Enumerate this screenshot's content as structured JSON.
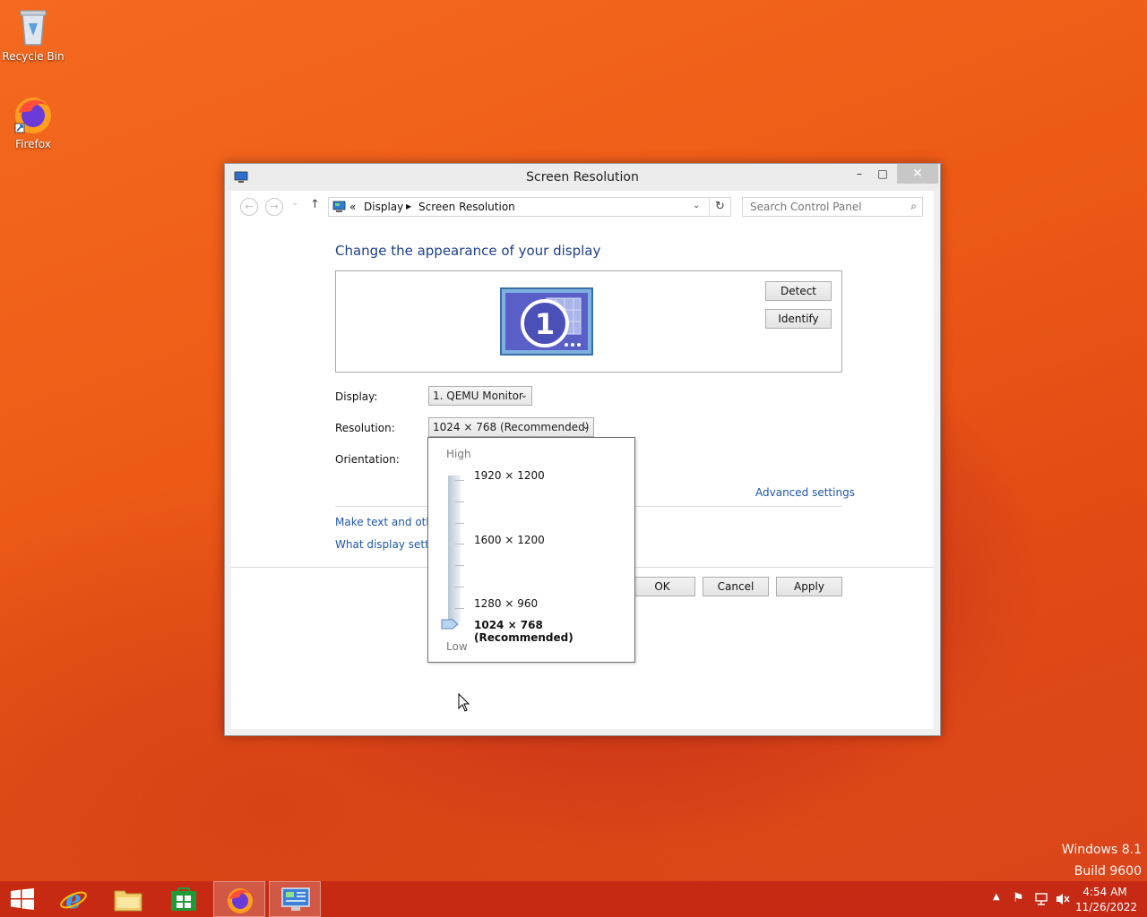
{
  "desktop": {
    "icons": [
      {
        "label": "Recycle Bin"
      },
      {
        "label": "Firefox"
      }
    ],
    "watermark": {
      "line1": "Windows 8.1",
      "line2": "Build 9600"
    }
  },
  "window": {
    "title": "Screen Resolution",
    "controls": {
      "minimize": "–",
      "maximize": "□",
      "close": "✕"
    },
    "nav": {
      "breadcrumb_prefix": "«",
      "breadcrumb": [
        "Display",
        "Screen Resolution"
      ],
      "search_placeholder": "Search Control Panel"
    },
    "heading": "Change the appearance of your display",
    "monitor_number": "1",
    "detect_label": "Detect",
    "identify_label": "Identify",
    "display_label": "Display:",
    "display_value": "1. QEMU Monitor",
    "resolution_label": "Resolution:",
    "resolution_value": "1024 × 768 (Recommended)",
    "orientation_label": "Orientation:",
    "advanced_link": "Advanced settings",
    "link_text_size": "Make text and other",
    "link_display_settings": "What display setting",
    "ok_label": "OK",
    "cancel_label": "Cancel",
    "apply_label": "Apply"
  },
  "resolution_dropdown": {
    "high_label": "High",
    "low_label": "Low",
    "options": [
      "1920 × 1200",
      "1600 × 1200",
      "1280 × 960",
      "1024 × 768 (Recommended)"
    ],
    "selected_index": 3
  },
  "taskbar": {
    "clock_time": "4:54 AM",
    "clock_date": "11/26/2022"
  },
  "colors": {
    "accent_heading": "#1e3f8a",
    "link": "#1e56a8",
    "taskbar": "#c42814"
  }
}
